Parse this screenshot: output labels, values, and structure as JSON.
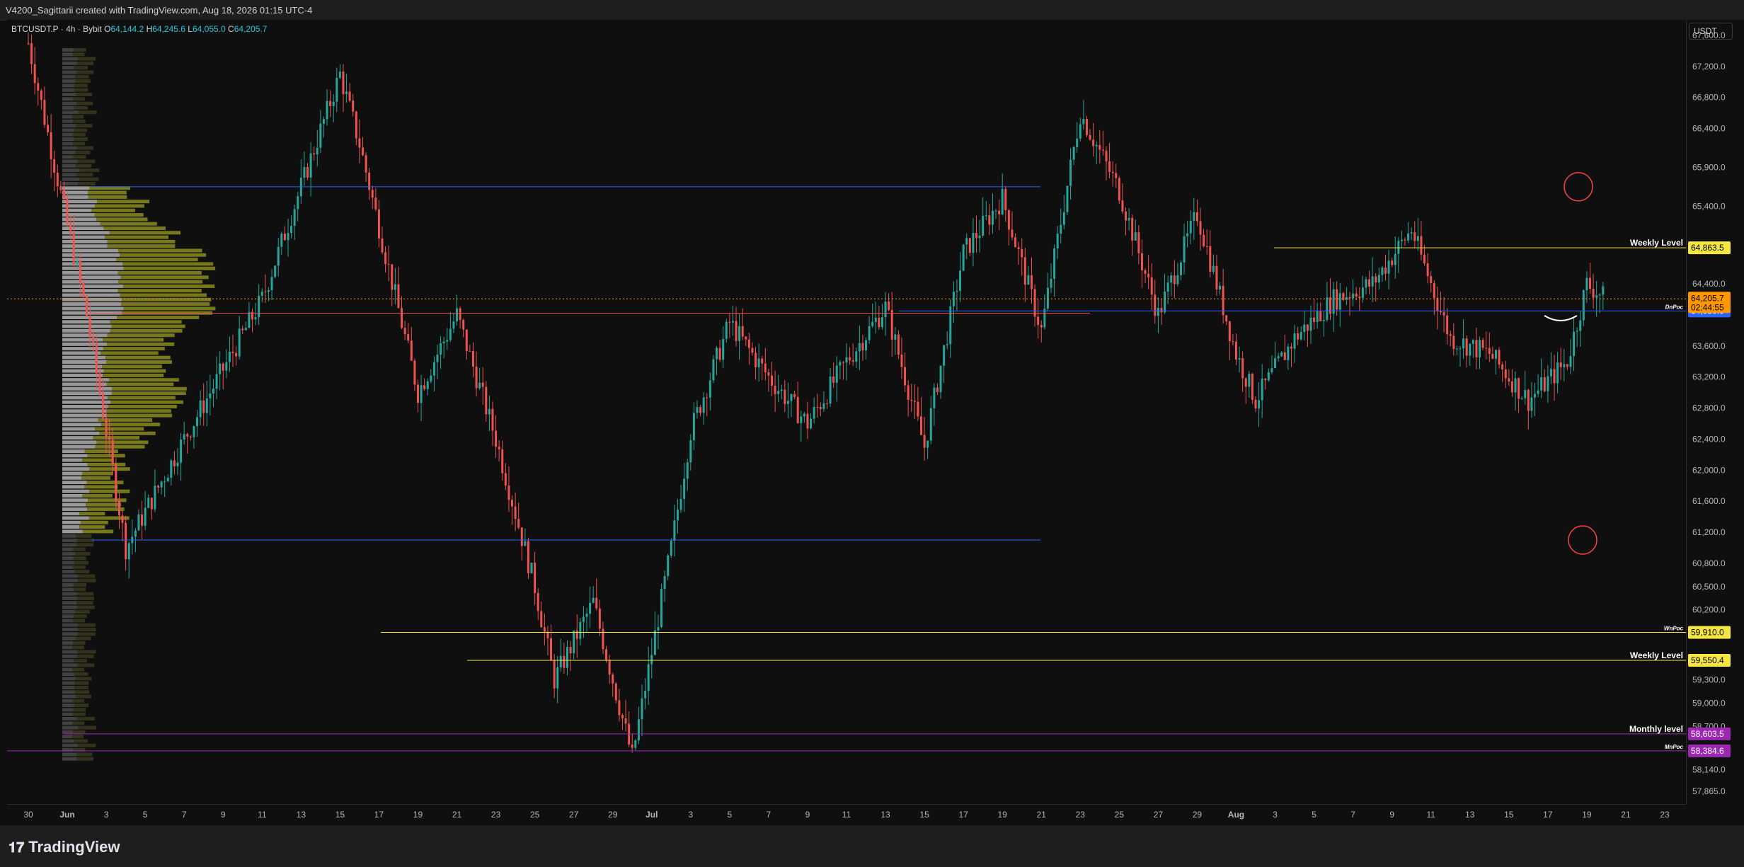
{
  "header": {
    "title": "V4200_Sagittarii created with TradingView.com, Aug 18, 2026 01:15 UTC-4"
  },
  "legend": {
    "symbol": "BTCUSDT.P · 4h · Bybit",
    "o_label": "O",
    "o_value": "64,144.2",
    "h_label": "H",
    "h_value": "64,245.6",
    "l_label": "L",
    "l_value": "64,055.0",
    "c_label": "C",
    "c_value": "64,205.7"
  },
  "price_scale": {
    "currency": "USDT",
    "ticks": [
      "67,600.0",
      "67,200.0",
      "66,800.0",
      "66,400.0",
      "65,900.0",
      "65,400.0",
      "64,400.0",
      "63,600.0",
      "63,200.0",
      "62,800.0",
      "62,400.0",
      "62,000.0",
      "61,600.0",
      "61,200.0",
      "60,800.0",
      "60,500.0",
      "60,200.0",
      "59,300.0",
      "59,000.0",
      "58,700.0",
      "58,140.0",
      "57,865.0"
    ]
  },
  "time_axis": {
    "labels": [
      "30",
      "Jun",
      "3",
      "5",
      "7",
      "9",
      "11",
      "13",
      "15",
      "17",
      "19",
      "21",
      "23",
      "25",
      "27",
      "29",
      "Jul",
      "3",
      "5",
      "7",
      "9",
      "11",
      "13",
      "15",
      "17",
      "19",
      "21",
      "23",
      "25",
      "27",
      "29",
      "Aug",
      "3",
      "5",
      "7",
      "9",
      "11",
      "13",
      "15",
      "17",
      "19",
      "21",
      "23"
    ]
  },
  "levels": [
    {
      "name": "Weekly Level",
      "value": "64,863.5",
      "color": "#f5e642"
    },
    {
      "name": "DnPoc",
      "value": "64,050.0",
      "color": "#2962ff"
    },
    {
      "name": "WnPoc",
      "value": "59,910.0",
      "color": "#f5e642"
    },
    {
      "name": "Weekly Level",
      "value": "59,550.4",
      "color": "#f5e642"
    },
    {
      "name": "Monthly level",
      "value": "58,603.5",
      "color": "#9c27b0"
    },
    {
      "name": "MnPoc",
      "value": "58,384.6",
      "color": "#9c27b0"
    }
  ],
  "last_price": {
    "value": "64,205.7",
    "countdown": "02:44:55",
    "color": "#ff9800"
  },
  "branding": {
    "logo": "TradingView"
  },
  "chart_data": {
    "type": "line",
    "title": "",
    "ylim": [
      57700,
      67800
    ],
    "candle_up_color": "#26a69a",
    "candle_down_color": "#ef5350",
    "series": [
      {
        "name": "",
        "x_days_from_May30": [
          0,
          3,
          5,
          8,
          12,
          16,
          17,
          20,
          22,
          24,
          26,
          27,
          29,
          31,
          33,
          34,
          36,
          38,
          40,
          42,
          44,
          46,
          48,
          50,
          52,
          54,
          56,
          58,
          60,
          62,
          63,
          65,
          67,
          69,
          71,
          73,
          75,
          77,
          79,
          80,
          81
        ],
        "values": [
          67500,
          64000,
          61000,
          62400,
          64200,
          67100,
          66200,
          63000,
          64000,
          62400,
          60500,
          59300,
          60300,
          58300,
          61000,
          62500,
          63900,
          63200,
          62600,
          63400,
          64100,
          62300,
          64800,
          65500,
          63800,
          66600,
          65600,
          64000,
          65300,
          63500,
          62900,
          63700,
          64200,
          64400,
          65100,
          63700,
          63500,
          62900,
          63400,
          64400,
          64200
        ]
      }
    ]
  },
  "annotations": [
    {
      "name": "top-circle",
      "color": "#ff4444"
    },
    {
      "name": "bottom-circle",
      "color": "#ff4444"
    },
    {
      "name": "level-blue-upper",
      "value": 65650,
      "color": "#2962ff"
    },
    {
      "name": "level-blue-lower",
      "value": 61100,
      "color": "#2962ff"
    },
    {
      "name": "level-red",
      "value": 64020,
      "color": "#ef5350"
    }
  ]
}
